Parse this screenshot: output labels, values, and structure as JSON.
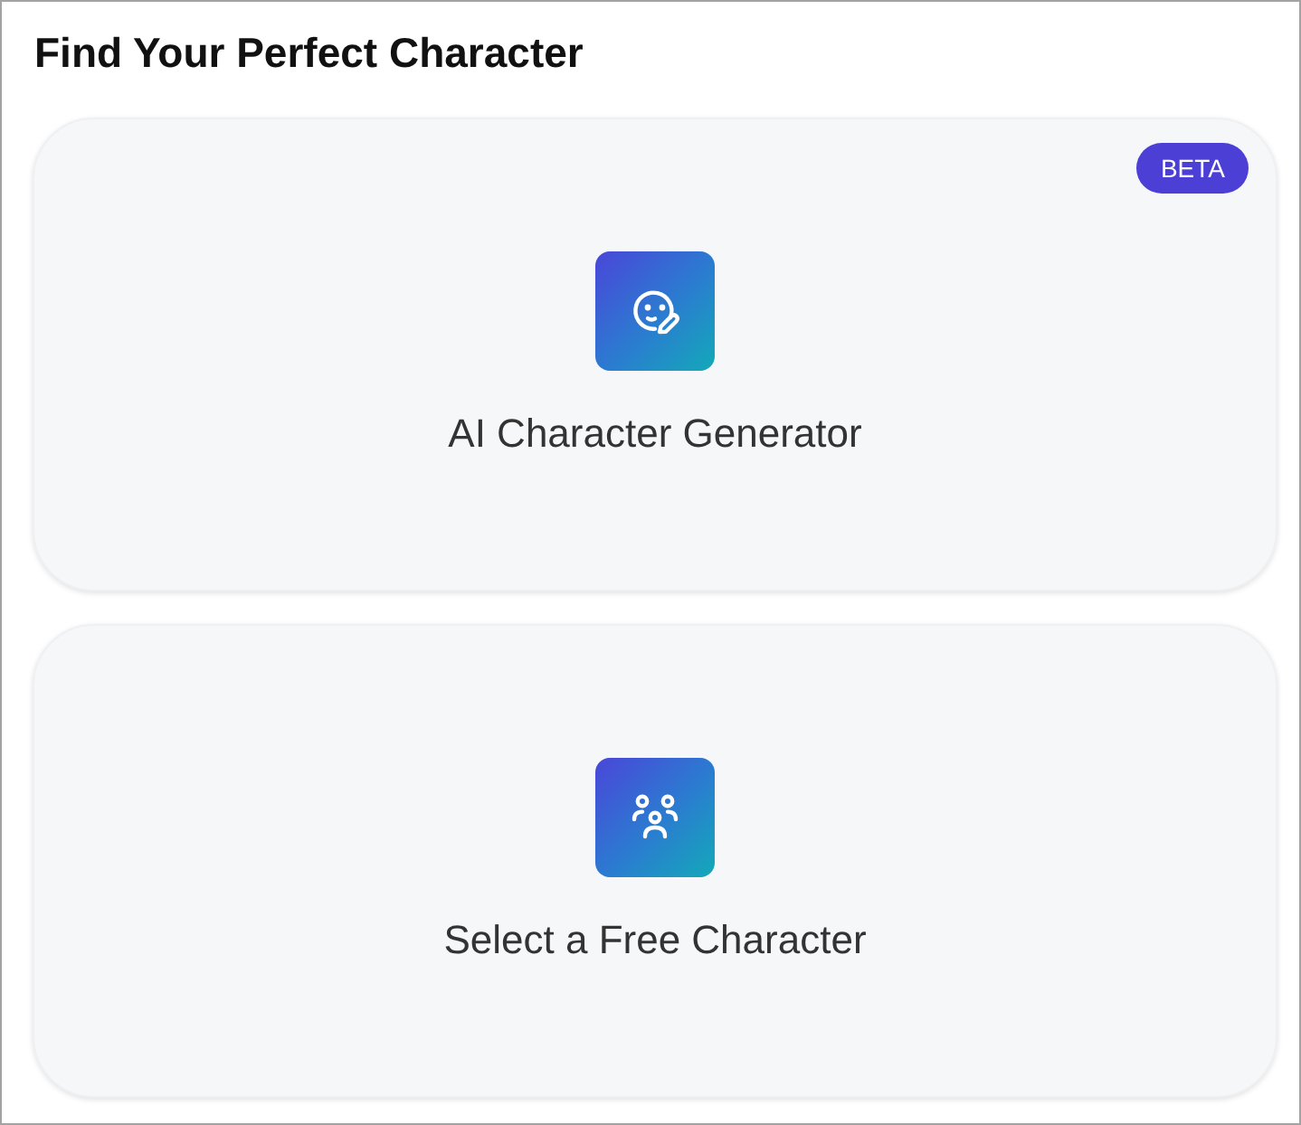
{
  "title": "Find Your Perfect Character",
  "options": [
    {
      "kind": "generator",
      "label": "AI Character Generator",
      "badge": "BETA"
    },
    {
      "kind": "library",
      "label": "Select a Free Character"
    }
  ]
}
